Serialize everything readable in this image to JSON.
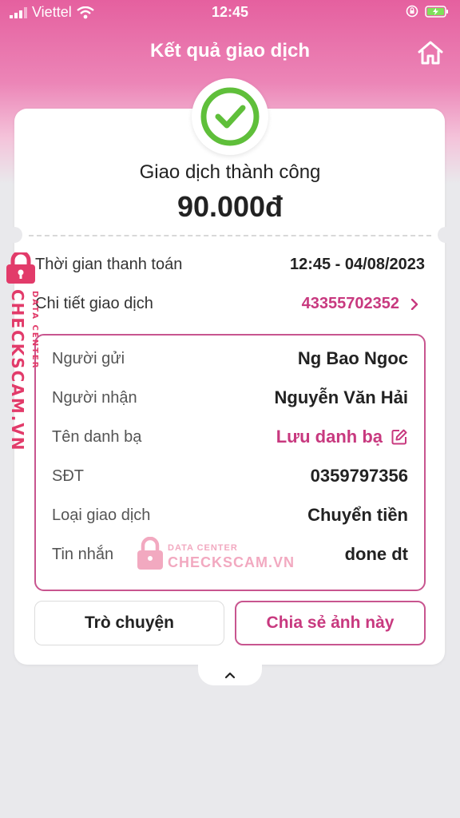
{
  "status_bar": {
    "carrier": "Viettel",
    "time": "12:45"
  },
  "header": {
    "title": "Kết quả giao dịch",
    "home_icon": "home-icon"
  },
  "result": {
    "status_icon": "check-circle-icon",
    "title": "Giao dịch thành công",
    "amount": "90.000đ"
  },
  "summary": {
    "time_label": "Thời gian thanh toán",
    "time_value": "12:45 - 04/08/2023",
    "detail_label": "Chi tiết giao dịch",
    "detail_value": "43355702352"
  },
  "details": [
    {
      "label": "Người gửi",
      "value": "Ng Bao Ngoc"
    },
    {
      "label": "Người nhận",
      "value": "Nguyễn Văn Hải"
    },
    {
      "label": "Tên danh bạ",
      "value": "Lưu danh bạ"
    },
    {
      "label": "SĐT",
      "value": "0359797356"
    },
    {
      "label": "Loại giao dịch",
      "value": "Chuyển tiền"
    },
    {
      "label": "Tin nhắn",
      "value": "done dt"
    }
  ],
  "buttons": {
    "chat": "Trò chuyện",
    "share": "Chia sẻ ảnh này"
  },
  "watermark": {
    "line1": "DATA CENTER",
    "line2": "CHECKSCAM.VN"
  },
  "colors": {
    "accent": "#c8397f",
    "success": "#5fbf3a",
    "header_pink": "#e5609f"
  }
}
